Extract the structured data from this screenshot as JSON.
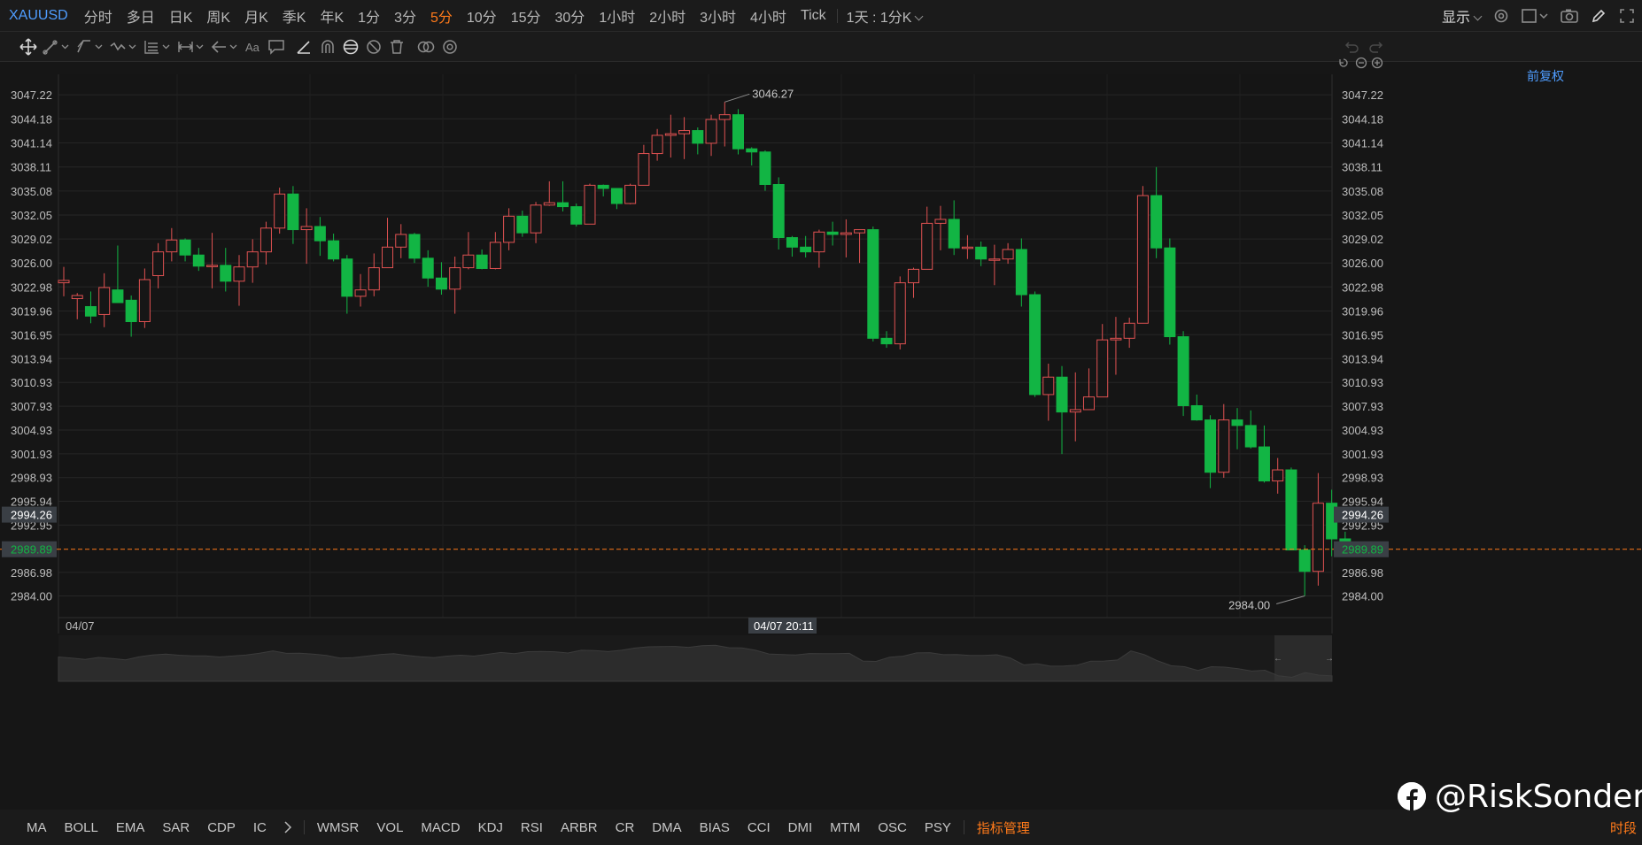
{
  "symbol": "XAUUSD",
  "periods": [
    "分时",
    "多日",
    "日K",
    "周K",
    "月K",
    "季K",
    "年K",
    "1分",
    "3分",
    "5分",
    "10分",
    "15分",
    "30分",
    "1小时",
    "2小时",
    "3小时",
    "4小时",
    "Tick"
  ],
  "active_period": "5分",
  "multi_tf": "1天 : 1分K",
  "display_label": "显示",
  "fuquan_label": "前复权",
  "indicators": [
    "MA",
    "BOLL",
    "EMA",
    "SAR",
    "CDP",
    "IC",
    "WMSR",
    "VOL",
    "MACD",
    "KDJ",
    "RSI",
    "ARBR",
    "CR",
    "DMA",
    "BIAS",
    "CCI",
    "DMI",
    "MTM",
    "OSC",
    "PSY"
  ],
  "indicator_manage": "指标管理",
  "time_section": "时段",
  "watermark": "@RiskSonder",
  "colors": {
    "up": "#e05252",
    "down": "#12b544",
    "accent": "#ff7a1a",
    "link": "#4f9dff",
    "grid": "#262626"
  },
  "chart_data": {
    "type": "candlestick",
    "ylim": [
      2981.0,
      3050.2
    ],
    "y_ticks": [
      "3047.22",
      "3044.18",
      "3041.14",
      "3038.11",
      "3035.08",
      "3032.05",
      "3029.02",
      "3026.00",
      "3022.98",
      "3019.96",
      "3016.95",
      "3013.94",
      "3010.93",
      "3007.93",
      "3004.93",
      "3001.93",
      "2998.93",
      "2995.94",
      "2992.95",
      "2986.98",
      "2984.00"
    ],
    "crosshair_price": "2994.26",
    "last_price": "2989.89",
    "x_start_label": "04/07",
    "crosshair_time": "04/07 20:11",
    "high_label": "3046.27",
    "low_label": "2984.00",
    "candles": [
      [
        3023.5,
        3025.5,
        3021.8,
        3023.8
      ],
      [
        3021.5,
        3022.2,
        3018.9,
        3021.9
      ],
      [
        3020.5,
        3022.4,
        3018.4,
        3019.3
      ],
      [
        3019.5,
        3024.7,
        3017.9,
        3022.9
      ],
      [
        3022.6,
        3028.2,
        3021.3,
        3021.0
      ],
      [
        3021.3,
        3021.9,
        3016.7,
        3018.6
      ],
      [
        3018.6,
        3025.3,
        3017.8,
        3023.9
      ],
      [
        3024.4,
        3028.5,
        3022.8,
        3027.4
      ],
      [
        3027.4,
        3030.4,
        3026.2,
        3028.9
      ],
      [
        3028.9,
        3029.1,
        3026.2,
        3027.0
      ],
      [
        3027.0,
        3027.9,
        3025.0,
        3025.6
      ],
      [
        3025.7,
        3029.8,
        3022.8,
        3025.7
      ],
      [
        3025.7,
        3027.9,
        3022.4,
        3023.7
      ],
      [
        3023.7,
        3027.0,
        3020.6,
        3025.5
      ],
      [
        3025.5,
        3029.0,
        3023.5,
        3027.4
      ],
      [
        3027.4,
        3031.2,
        3025.8,
        3030.4
      ],
      [
        3030.4,
        3035.5,
        3029.7,
        3034.7
      ],
      [
        3034.7,
        3035.7,
        3028.4,
        3030.2
      ],
      [
        3030.2,
        3032.9,
        3025.9,
        3030.6
      ],
      [
        3030.6,
        3031.8,
        3026.9,
        3028.8
      ],
      [
        3028.8,
        3029.7,
        3026.2,
        3026.5
      ],
      [
        3026.5,
        3027.0,
        3019.6,
        3021.8
      ],
      [
        3021.8,
        3024.6,
        3020.5,
        3022.6
      ],
      [
        3022.6,
        3027.2,
        3021.8,
        3025.4
      ],
      [
        3025.4,
        3031.7,
        3025.4,
        3028.0
      ],
      [
        3028.0,
        3030.9,
        3026.6,
        3029.6
      ],
      [
        3029.6,
        3029.8,
        3026.0,
        3026.6
      ],
      [
        3026.6,
        3027.6,
        3023.0,
        3024.1
      ],
      [
        3024.1,
        3026.1,
        3022.0,
        3022.7
      ],
      [
        3022.7,
        3026.8,
        3019.6,
        3025.4
      ],
      [
        3025.4,
        3029.9,
        3025.2,
        3027.0
      ],
      [
        3027.0,
        3027.7,
        3025.2,
        3025.3
      ],
      [
        3025.3,
        3029.9,
        3025.2,
        3028.6
      ],
      [
        3028.6,
        3032.9,
        3027.6,
        3031.9
      ],
      [
        3031.9,
        3032.6,
        3029.3,
        3029.8
      ],
      [
        3029.8,
        3033.7,
        3028.5,
        3033.3
      ],
      [
        3033.3,
        3036.3,
        3033.2,
        3033.6
      ],
      [
        3033.6,
        3036.3,
        3032.5,
        3033.1
      ],
      [
        3033.1,
        3033.5,
        3030.6,
        3030.9
      ],
      [
        3030.9,
        3036.0,
        3030.9,
        3035.8
      ],
      [
        3035.8,
        3035.9,
        3034.4,
        3035.4
      ],
      [
        3035.4,
        3035.4,
        3032.8,
        3033.5
      ],
      [
        3033.5,
        3036.0,
        3033.4,
        3035.8
      ],
      [
        3035.8,
        3040.9,
        3035.8,
        3039.8
      ],
      [
        3039.8,
        3042.9,
        3038.9,
        3042.1
      ],
      [
        3042.1,
        3044.7,
        3039.3,
        3042.3
      ],
      [
        3042.3,
        3044.4,
        3039.1,
        3042.7
      ],
      [
        3042.7,
        3043.1,
        3039.7,
        3041.1
      ],
      [
        3041.1,
        3044.7,
        3039.5,
        3044.1
      ],
      [
        3044.1,
        3046.3,
        3040.7,
        3044.7
      ],
      [
        3044.7,
        3045.4,
        3039.7,
        3040.4
      ],
      [
        3040.4,
        3040.6,
        3038.3,
        3040.0
      ],
      [
        3040.0,
        3040.2,
        3035.1,
        3035.9
      ],
      [
        3035.9,
        3036.8,
        3027.7,
        3029.2
      ],
      [
        3029.2,
        3029.4,
        3026.8,
        3028.0
      ],
      [
        3028.0,
        3029.4,
        3026.7,
        3027.4
      ],
      [
        3027.4,
        3030.2,
        3025.4,
        3029.9
      ],
      [
        3029.9,
        3031.2,
        3028.2,
        3029.6
      ],
      [
        3029.6,
        3031.5,
        3026.7,
        3029.8
      ],
      [
        3029.8,
        3030.2,
        3026.0,
        3030.2
      ],
      [
        3030.2,
        3030.6,
        3016.1,
        3016.5
      ],
      [
        3016.5,
        3017.4,
        3015.3,
        3015.8
      ],
      [
        3015.8,
        3024.3,
        3015.1,
        3023.5
      ],
      [
        3023.5,
        3025.4,
        3021.6,
        3025.2
      ],
      [
        3025.2,
        3033.1,
        3025.2,
        3031.0
      ],
      [
        3031.0,
        3033.2,
        3027.6,
        3031.5
      ],
      [
        3031.5,
        3033.9,
        3027.0,
        3027.9
      ],
      [
        3027.9,
        3029.5,
        3026.5,
        3028.0
      ],
      [
        3028.0,
        3028.7,
        3025.6,
        3026.5
      ],
      [
        3026.5,
        3028.3,
        3023.2,
        3026.5
      ],
      [
        3026.5,
        3028.5,
        3025.9,
        3027.7
      ],
      [
        3027.7,
        3029.1,
        3020.5,
        3022.0
      ],
      [
        3022.0,
        3022.4,
        3009.1,
        3009.4
      ],
      [
        3009.4,
        3013.3,
        3006.1,
        3011.6
      ],
      [
        3011.6,
        3013.0,
        3001.9,
        3007.2
      ],
      [
        3007.2,
        3012.2,
        3003.5,
        3007.5
      ],
      [
        3007.5,
        3012.7,
        3007.5,
        3009.1
      ],
      [
        3009.1,
        3018.3,
        3009.1,
        3016.3
      ],
      [
        3016.3,
        3019.2,
        3011.9,
        3016.5
      ],
      [
        3016.5,
        3019.1,
        3015.3,
        3018.4
      ],
      [
        3018.4,
        3035.7,
        3018.4,
        3034.5
      ],
      [
        3034.5,
        3038.1,
        3026.6,
        3027.9
      ],
      [
        3027.9,
        3029.1,
        3015.7,
        3016.7
      ],
      [
        3016.7,
        3017.4,
        3006.7,
        3008.0
      ],
      [
        3008.0,
        3009.4,
        3006.1,
        3006.2
      ],
      [
        3006.2,
        3006.8,
        2997.6,
        2999.6
      ],
      [
        2999.6,
        3008.2,
        2998.9,
        3006.2
      ],
      [
        3006.2,
        3007.7,
        3002.5,
        3005.5
      ],
      [
        3005.5,
        3007.4,
        3002.6,
        3002.8
      ],
      [
        3002.8,
        3005.5,
        2998.3,
        2998.5
      ],
      [
        2998.5,
        3001.4,
        2996.9,
        2999.9
      ],
      [
        2999.9,
        3000.2,
        2995.6,
        2989.8
      ],
      [
        2989.8,
        2990.4,
        2984.0,
        2987.1
      ],
      [
        2987.1,
        2999.5,
        2985.3,
        2995.7
      ],
      [
        2995.7,
        2997.4,
        2989.0,
        2991.2
      ],
      [
        2991.2,
        2992.1,
        2990.0,
        2989.9
      ]
    ],
    "grid": true
  }
}
